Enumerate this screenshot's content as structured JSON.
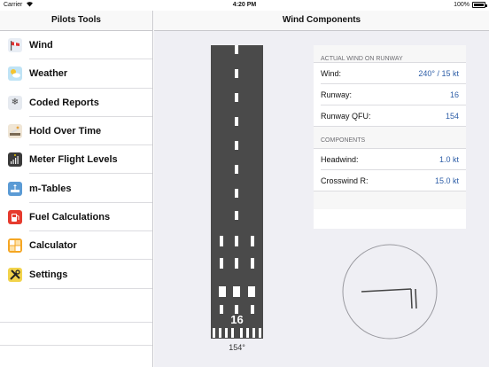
{
  "status_bar": {
    "carrier": "Carrier",
    "time": "4:20 PM",
    "battery": "100%"
  },
  "sidebar": {
    "title": "Pilots Tools",
    "items": [
      {
        "label": "Wind",
        "icon": "windsock-icon"
      },
      {
        "label": "Weather",
        "icon": "weather-icon"
      },
      {
        "label": "Coded Reports",
        "icon": "snowflake-icon"
      },
      {
        "label": "Hold Over Time",
        "icon": "deicing-icon"
      },
      {
        "label": "Meter Flight Levels",
        "icon": "altimeter-icon"
      },
      {
        "label": "m-Tables",
        "icon": "meter-table-icon"
      },
      {
        "label": "Fuel Calculations",
        "icon": "fuel-pump-icon"
      },
      {
        "label": "Calculator",
        "icon": "calculator-icon"
      },
      {
        "label": "Settings",
        "icon": "tools-icon"
      }
    ]
  },
  "detail": {
    "title": "Wind Components",
    "runway_number": "16",
    "runway_heading_label": "154°",
    "sections": [
      {
        "header": "ACTUAL WIND ON RUNWAY",
        "rows": [
          {
            "label": "Wind:",
            "value": "240° / 15 kt"
          },
          {
            "label": "Runway:",
            "value": "16"
          },
          {
            "label": "Runway QFU:",
            "value": "154"
          }
        ]
      },
      {
        "header": "COMPONENTS",
        "rows": [
          {
            "label": "Headwind:",
            "value": "1.0 kt"
          },
          {
            "label": "Crosswind R:",
            "value": "15.0 kt"
          }
        ]
      }
    ]
  },
  "colors": {
    "value_blue": "#2f5fa8",
    "runway_gray": "#4a4a4a",
    "background": "#efeff4"
  }
}
